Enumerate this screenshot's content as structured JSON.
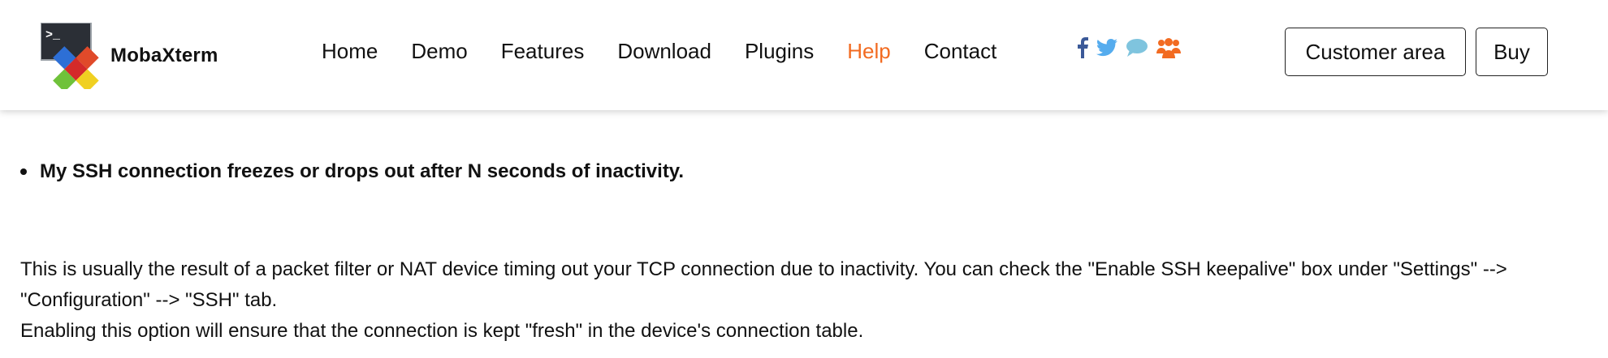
{
  "brand": {
    "name": "MobaXterm",
    "logo_prompt": ">_"
  },
  "nav": {
    "items": [
      {
        "label": "Home",
        "active": false
      },
      {
        "label": "Demo",
        "active": false
      },
      {
        "label": "Features",
        "active": false
      },
      {
        "label": "Download",
        "active": false
      },
      {
        "label": "Plugins",
        "active": false
      },
      {
        "label": "Help",
        "active": true
      },
      {
        "label": "Contact",
        "active": false
      }
    ]
  },
  "social": {
    "icons": [
      "facebook-icon",
      "twitter-icon",
      "chat-bubble-icon",
      "community-icon"
    ]
  },
  "actions": {
    "customer_area_label": "Customer area",
    "buy_label": "Buy"
  },
  "faq": {
    "question": "My SSH connection freezes or drops out after N seconds of inactivity.",
    "answer_line_1": "This is usually the result of a packet filter or NAT device timing out your TCP connection due to inactivity. You can check the \"Enable SSH keepalive\" box under \"Settings\" --> \"Configuration\" --> \"SSH\" tab.",
    "answer_line_2": "Enabling this option will ensure that the connection is kept \"fresh\" in the device's connection table."
  },
  "colors": {
    "accent": "#f26b21",
    "facebook": "#3b5998",
    "twitter": "#55acee",
    "chat": "#7fc4de",
    "community": "#f26b21"
  }
}
